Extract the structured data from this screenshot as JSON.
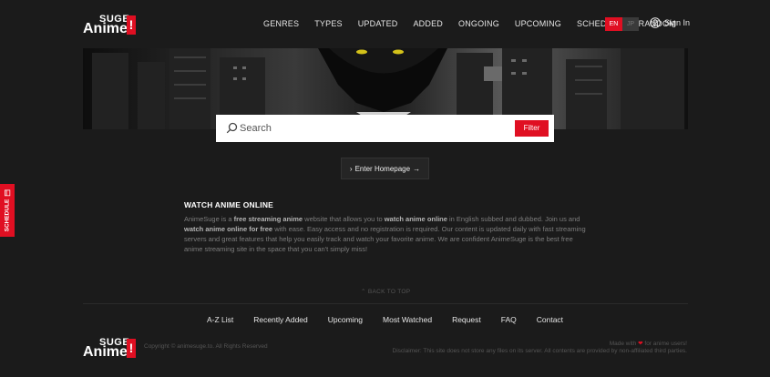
{
  "brand": {
    "top": "SUGE",
    "main": "Anime",
    "mark": "!"
  },
  "nav": [
    "GENRES",
    "TYPES",
    "UPDATED",
    "ADDED",
    "ONGOING",
    "UPCOMING",
    "SCHEDULE",
    "RANDOM"
  ],
  "lang": {
    "active": "EN",
    "alt": "JP"
  },
  "signin": "Sign In",
  "search": {
    "placeholder": "Search",
    "filter_label": "Filter"
  },
  "enter_button": "Enter Homepage",
  "about": {
    "title": "WATCH ANIME ONLINE",
    "p_a": "AnimeSuge is a ",
    "b_a": "free streaming anime",
    "p_b": " website that allows you to ",
    "b_b": "watch anime online",
    "p_c": " in English subbed and dubbed. Join us and ",
    "b_c": "watch anime online for free",
    "p_d": " with ease. Easy access and no registration is required. Our content is updated daily with fast streaming servers and great features that help you easily track and watch your favorite anime. We are confident AnimeSuge is the best free anime streaming site in the space that you can't simply miss!"
  },
  "schedule_tab": "SCHEDULE",
  "back_to_top": "BACK TO TOP",
  "footer": {
    "links": [
      "A-Z List",
      "Recently Added",
      "Upcoming",
      "Most Watched",
      "Request",
      "FAQ",
      "Contact"
    ],
    "copyright": "Copyright © animesuge.to. All Rights Reserved",
    "made_a": "Made with",
    "made_b": "for anime users!",
    "disclaimer": "Disclaimer: This site does not store any files on its server. All contents are provided by non-affiliated third parties."
  },
  "colors": {
    "accent": "#e00f22",
    "background": "#1b1b1b"
  }
}
